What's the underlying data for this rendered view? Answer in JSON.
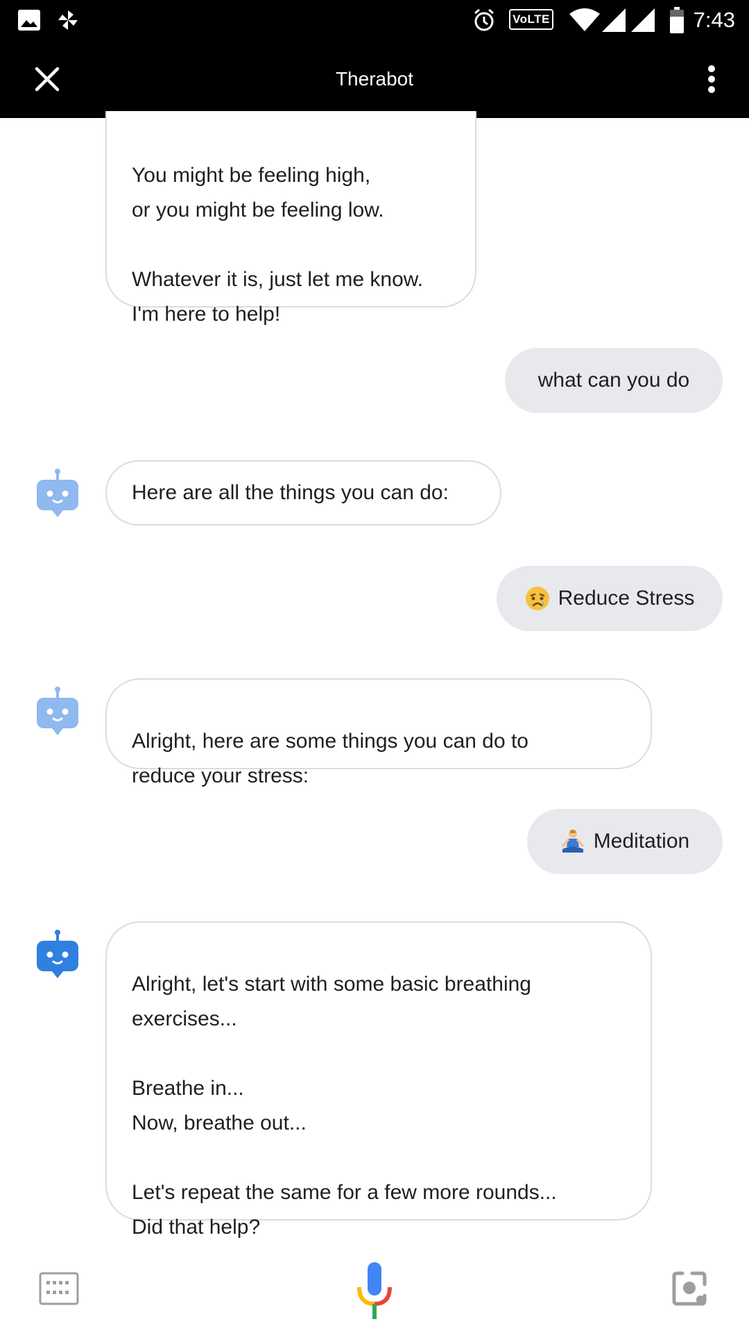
{
  "status_bar": {
    "time": "7:43",
    "network_badge": "VoLTE",
    "icons": [
      "gallery-icon",
      "pinwheel-icon",
      "alarm-icon",
      "wifi-icon",
      "signal-icon",
      "signal-icon",
      "battery-icon"
    ]
  },
  "app_bar": {
    "title": "Therabot",
    "close_icon": "close-icon",
    "menu_icon": "more-vert-icon"
  },
  "messages": [
    {
      "from": "bot",
      "text": "You might be feeling high,\nor you might be feeling low.\n\nWhatever it is, just let me know.\nI'm here to help!"
    },
    {
      "from": "user",
      "text": "what can you do"
    },
    {
      "from": "bot",
      "text": "Here are all the things you can do:"
    },
    {
      "from": "user",
      "text": "Reduce Stress",
      "emoji": "sad-face-emoji"
    },
    {
      "from": "bot",
      "text": "Alright, here are some things you can do to\nreduce your stress:"
    },
    {
      "from": "user",
      "text": "Meditation",
      "emoji": "meditating-person-emoji"
    },
    {
      "from": "bot",
      "text": "Alright, let's start with some basic breathing\nexercises...\n\nBreathe in...\nNow, breathe out...\n\nLet's repeat the same for a few more rounds...\nDid that help?"
    }
  ],
  "bottom_bar": {
    "icons": [
      "keyboard-icon",
      "microphone-icon",
      "lens-icon"
    ]
  },
  "colors": {
    "bar_background": "#000000",
    "user_bubble": "#e8e9ec",
    "bot_bubble_border": "#dcdcdc",
    "avatar_faded": "#8fb9ef",
    "avatar_active": "#2f80e0"
  }
}
